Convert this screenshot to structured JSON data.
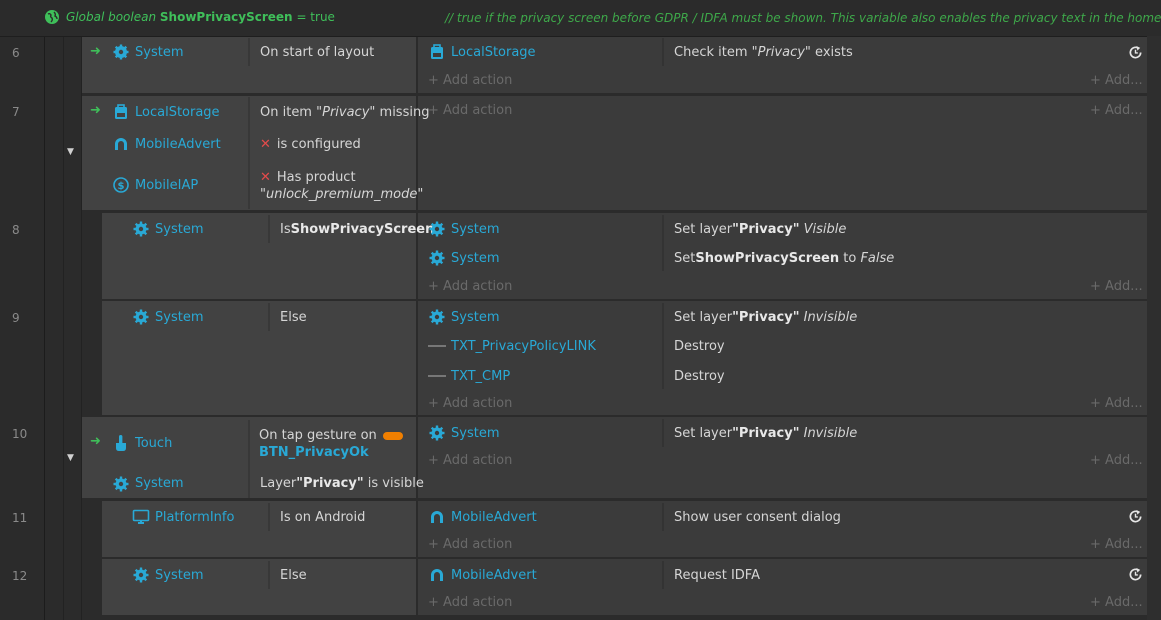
{
  "header": {
    "prefix": "Global boolean",
    "var_name": "ShowPrivacyScreen",
    "assign": "= true",
    "comment": "//  true if the privacy screen before GDPR / IDFA must be shown. This variable also enables the privacy text in the homepage"
  },
  "common": {
    "add_action": "+ Add action",
    "add_more": "+ Add..."
  },
  "rows": {
    "r6": {
      "num": "6",
      "cond_object": "System",
      "cond_text": "On start of layout",
      "act_object": "LocalStorage",
      "act_pre": "Check item ",
      "act_quote": "\"Privacy\"",
      "act_post": " exists"
    },
    "r7": {
      "num": "7",
      "c1_object": "LocalStorage",
      "c1_pre": "On item ",
      "c1_quote": "\"Privacy\"",
      "c1_post": " missing",
      "c2_object": "MobileAdvert",
      "c2_text": "is configured",
      "c3_object": "MobileIAP",
      "c3_text": "Has product",
      "c3_param": "\"unlock_premium_mode\""
    },
    "r8": {
      "num": "8",
      "cond_object": "System",
      "cond_pre": "Is ",
      "cond_bold": "ShowPrivacyScreen",
      "a1_object": "System",
      "a1_pre": "Set layer ",
      "a1_bold": "\"Privacy\"",
      "a1_post": " Visible",
      "a2_object": "System",
      "a2_pre": "Set ",
      "a2_bold": "ShowPrivacyScreen",
      "a2_mid": " to ",
      "a2_post": "False"
    },
    "r9": {
      "num": "9",
      "cond_object": "System",
      "cond_text": "Else",
      "a1_object": "System",
      "a1_pre": "Set layer ",
      "a1_bold": "\"Privacy\"",
      "a1_post": " Invisible",
      "a2_object": "TXT_PrivacyPolicyLINK",
      "a2_text": "Destroy",
      "a3_object": "TXT_CMP",
      "a3_text": "Destroy"
    },
    "r10": {
      "num": "10",
      "c1_object": "Touch",
      "c1_text": "On tap gesture on",
      "c1_param": "BTN_PrivacyOk",
      "c2_object": "System",
      "c2_pre": "Layer ",
      "c2_bold": "\"Privacy\"",
      "c2_post": " is visible",
      "a1_object": "System",
      "a1_pre": "Set layer ",
      "a1_bold": "\"Privacy\"",
      "a1_post": " Invisible"
    },
    "r11": {
      "num": "11",
      "cond_object": "PlatformInfo",
      "cond_text": "Is on Android",
      "act_object": "MobileAdvert",
      "act_text": "Show user consent dialog"
    },
    "r12": {
      "num": "12",
      "cond_object": "System",
      "cond_text": "Else",
      "act_object": "MobileAdvert",
      "act_text": "Request IDFA"
    }
  },
  "colors": {
    "object": "#29a9d6",
    "comment": "#3ea84a",
    "trigger_arrow": "#3fbf5a",
    "invert_x": "#e34b4b",
    "toggle": "#f07f00"
  }
}
